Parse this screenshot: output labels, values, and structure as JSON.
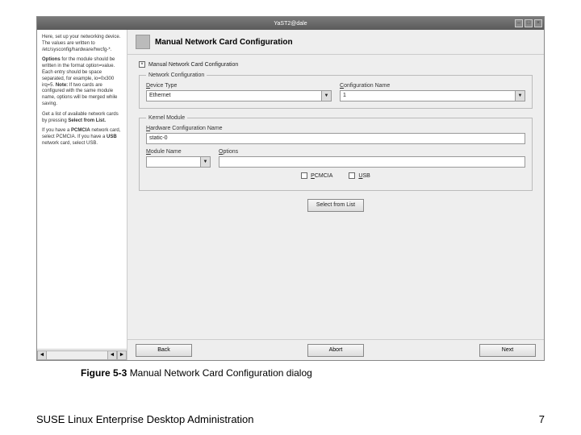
{
  "window": {
    "title": "YaST2@dale"
  },
  "sidebar": {
    "p1": "Here, set up your networking device. The values are written to /etc/sysconfig/hardware/hwcfg-*.",
    "p2a": "Options ",
    "p2b": "for the module should be written in the format option=value. Each entry should be space separated, for example, io=0x300 irq=5. ",
    "p2c": "Note:",
    "p2d": " If two cards are configured with the same module name, options will be merged while saving.",
    "p3a": "Get a list of available network cards by pressing ",
    "p3b": "Select from List.",
    "p4a": "If you have a ",
    "p4b": "PCMCIA",
    "p4c": " network card, select PCMCIA. If you have a ",
    "p4d": "USB",
    "p4e": " network card, select USB."
  },
  "header": {
    "title": "Manual Network Card Configuration"
  },
  "form": {
    "topCheckLabel": "Manual Network Card Configuration",
    "netconf": {
      "legend": "Network Configuration",
      "deviceTypeLabel": "Device Type",
      "deviceTypeValue": "Ethernet",
      "configNameLabel": "Configuration Name",
      "configNameValue": "1"
    },
    "kernel": {
      "legend": "Kernel Module",
      "hwcfgLabel": "Hardware Configuration Name",
      "hwcfgValue": "static-0",
      "moduleLabel": "Module Name",
      "optionsLabel": "Options",
      "pcmcia": "PCMCIA",
      "usb": "USB"
    },
    "selectBtn": "Select from List"
  },
  "buttons": {
    "back": "Back",
    "abort": "Abort",
    "next": "Next"
  },
  "caption": {
    "bold": "Figure 5-3 ",
    "rest": "Manual Network Card Configuration dialog"
  },
  "docFooter": {
    "left": "SUSE Linux Enterprise Desktop Administration",
    "right": "7"
  }
}
